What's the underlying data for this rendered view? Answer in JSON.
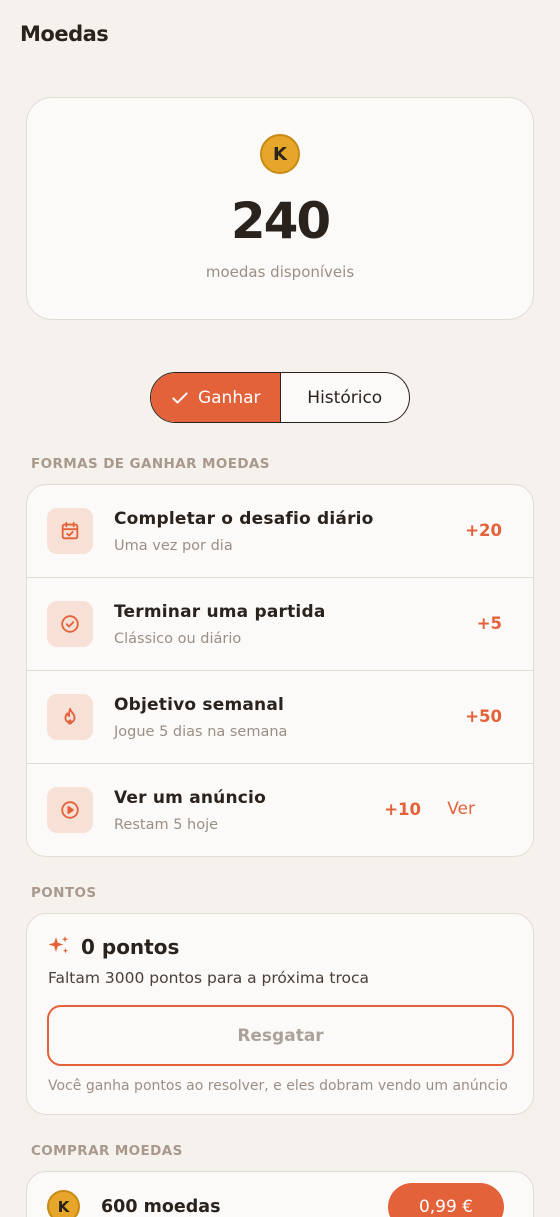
{
  "page": {
    "title": "Moedas"
  },
  "balance": {
    "coin_symbol": "K",
    "amount": "240",
    "label": "moedas disponíveis"
  },
  "tabs": [
    {
      "label": "Ganhar",
      "active": true,
      "icon": "check-icon"
    },
    {
      "label": "Histórico",
      "active": false
    }
  ],
  "earn": {
    "section_label": "FORMAS DE GANHAR MOEDAS",
    "items": [
      {
        "title": "Completar o desafio diário",
        "subtitle": "Uma vez por dia",
        "reward": "+20",
        "icon": "calendar-check-icon"
      },
      {
        "title": "Terminar uma partida",
        "subtitle": "Clássico ou diário",
        "reward": "+5",
        "icon": "check-circle-icon"
      },
      {
        "title": "Objetivo semanal",
        "subtitle": "Jogue 5 dias na semana",
        "reward": "+50",
        "icon": "flame-icon"
      },
      {
        "title": "Ver um anúncio",
        "subtitle": "Restam 5 hoje",
        "reward": "+10",
        "action": "Ver",
        "icon": "play-circle-icon"
      }
    ]
  },
  "points": {
    "section_label": "PONTOS",
    "title": "0 pontos",
    "description": "Faltam 3000 pontos para a próxima troca",
    "redeem_label": "Resgatar",
    "note": "Você ganha pontos ao resolver, e eles dobram vendo um anúncio",
    "icon": "sparkle-icon"
  },
  "buy": {
    "section_label": "COMPRAR MOEDAS",
    "items": [
      {
        "coin_symbol": "K",
        "label": "600 moedas",
        "price": "0,99 €"
      }
    ]
  },
  "colors": {
    "accent": "#e3623a",
    "background": "#f5f1ec",
    "card": "#fcfaf8",
    "coin": "#e6a62a"
  }
}
